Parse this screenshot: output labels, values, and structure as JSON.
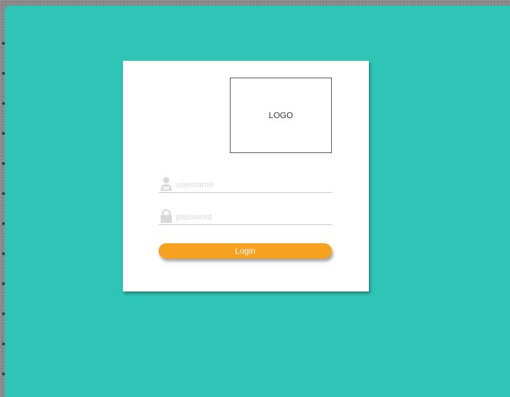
{
  "logo": {
    "label": "LOGO"
  },
  "form": {
    "username": {
      "placeholder": "username",
      "value": ""
    },
    "password": {
      "placeholder": "password",
      "value": ""
    },
    "login_label": "Login"
  },
  "colors": {
    "background": "#2ec5b6",
    "card": "#ffffff",
    "button": "#f7a120",
    "icon": "#d9d9d9"
  },
  "icons": {
    "username": "user-icon",
    "password": "lock-icon"
  }
}
